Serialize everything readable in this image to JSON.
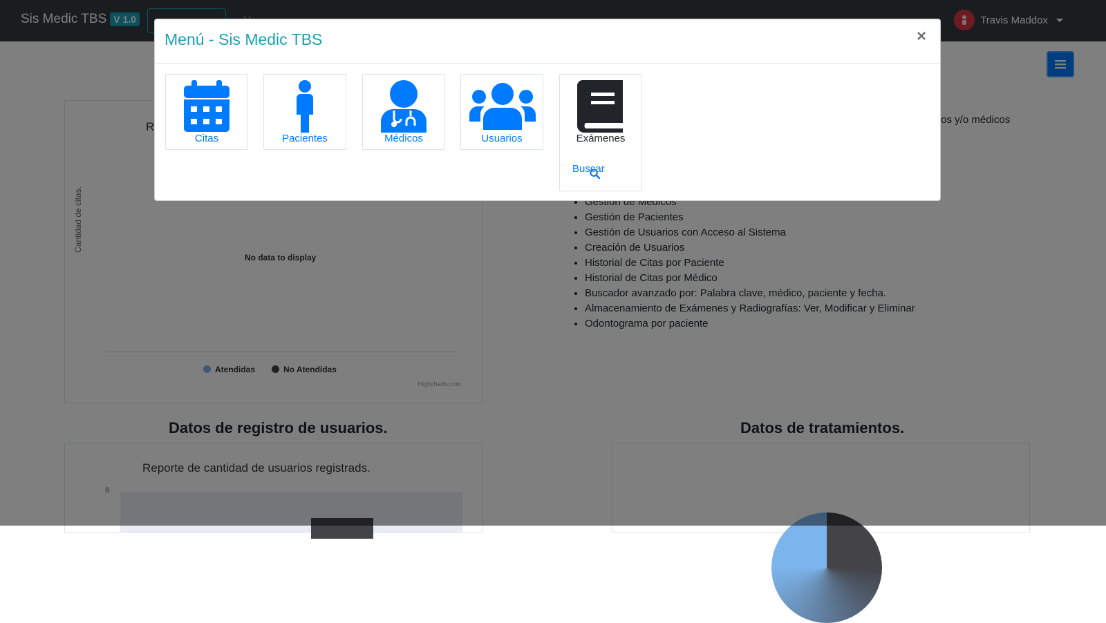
{
  "navbar": {
    "brand": "Sis Medic TBS",
    "version": "V 1.0",
    "faded_link": "H",
    "user_name": "Travis Maddox"
  },
  "background": {
    "chart1": {
      "title_fragment": "R",
      "ylabel": "Cantidad de citas.",
      "no_data": "No data to display",
      "legend": [
        "Atendidas",
        "No Atendidas"
      ],
      "legend_colors": [
        "#7cb5ec",
        "#434348"
      ],
      "credits": "Highcharts.com"
    },
    "section_users": "Datos de registro de usuarios.",
    "section_treatments": "Datos de tratamientos.",
    "chart2": {
      "title": "Reporte de cantidad de usuarios registrads.",
      "tick_top": "8"
    },
    "features_fragment": "dicos y/o médicos",
    "features": [
      "Gestión de Médicos",
      "Gestión de Pacientes",
      "Gestión de Usuarios con Acceso al Sistema",
      "Creación de Usuarios",
      "Historial de Citas por Paciente",
      "Historial de Citas por Médico",
      "Buscador avanzado por: Palabra clave, médico, paciente y fecha.",
      "Almacenamiento de Exámenes y Radiografías: Ver, Modificar y Eliminar",
      "Odontograma por paciente"
    ]
  },
  "modal": {
    "title": "Menú - Sis Medic TBS",
    "close": "×",
    "tiles": [
      {
        "label": "Citas",
        "icon": "calendar-icon"
      },
      {
        "label": "Pacientes",
        "icon": "person-icon"
      },
      {
        "label": "Médicos",
        "icon": "doctor-icon"
      },
      {
        "label": "Usuarios",
        "icon": "users-icon"
      },
      {
        "label": "Exámenes",
        "icon": "book-icon"
      }
    ],
    "search_label": "Buscar"
  },
  "colors": {
    "navbar": "#343a40",
    "accent": "#17a2b8",
    "primary": "#007bff"
  }
}
